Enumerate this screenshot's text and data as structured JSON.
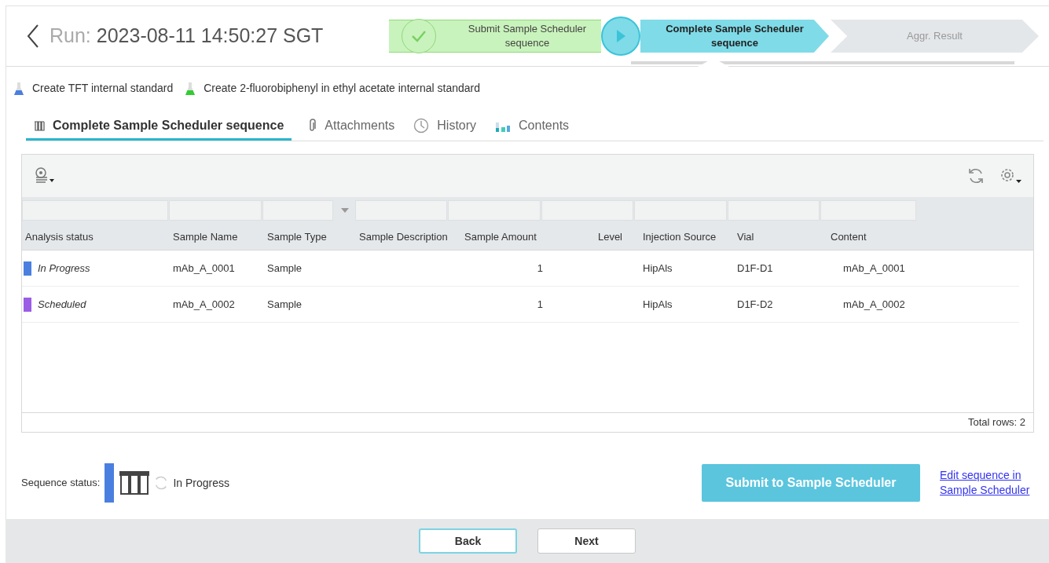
{
  "header": {
    "title_label": "Run:",
    "title_value": "2023-08-11 14:50:27 SGT"
  },
  "steps": [
    {
      "label": "Submit Sample Scheduler sequence",
      "kind": "done"
    },
    {
      "label": "Complete Sample Scheduler sequence",
      "kind": "current"
    },
    {
      "label": "Aggr. Result",
      "kind": "pending"
    }
  ],
  "tasks": [
    {
      "label": "Create TFT internal standard",
      "color": "#4a7fe0"
    },
    {
      "label": "Create 2-fluorobiphenyl in ethyl acetate internal standard",
      "color": "#33cc33"
    }
  ],
  "tabs": [
    {
      "label": "Complete Sample Scheduler sequence",
      "kind": "sequence",
      "selected": true
    },
    {
      "label": "Attachments",
      "kind": "attachments",
      "selected": false
    },
    {
      "label": "History",
      "kind": "history",
      "selected": false
    },
    {
      "label": "Contents",
      "kind": "contents",
      "selected": false
    }
  ],
  "table": {
    "columns": [
      "Analysis status",
      "Sample Name",
      "Sample Type",
      "Sample Description",
      "Sample Amount",
      "Level",
      "Injection Source",
      "Vial",
      "Content"
    ],
    "rows": [
      {
        "color": "#4a7fe0",
        "cells": [
          "In Progress",
          "mAb_A_0001",
          "Sample",
          "",
          "1",
          "",
          "HipAls",
          "D1F-D1",
          "mAb_A_0001"
        ]
      },
      {
        "color": "#9b5de5",
        "cells": [
          "Scheduled",
          "mAb_A_0002",
          "Sample",
          "",
          "1",
          "",
          "HipAls",
          "D1F-D2",
          "mAb_A_0002"
        ]
      }
    ],
    "total": "Total rows: 2"
  },
  "sequence_status": {
    "label": "Sequence status:",
    "value": "In Progress",
    "color": "#4a7fe0"
  },
  "submit_button": "Submit to Sample Scheduler",
  "edit_link": "Edit sequence in Sample Scheduler",
  "nav_buttons": [
    {
      "label": "Back",
      "focused": true
    },
    {
      "label": "Next",
      "focused": false
    }
  ]
}
